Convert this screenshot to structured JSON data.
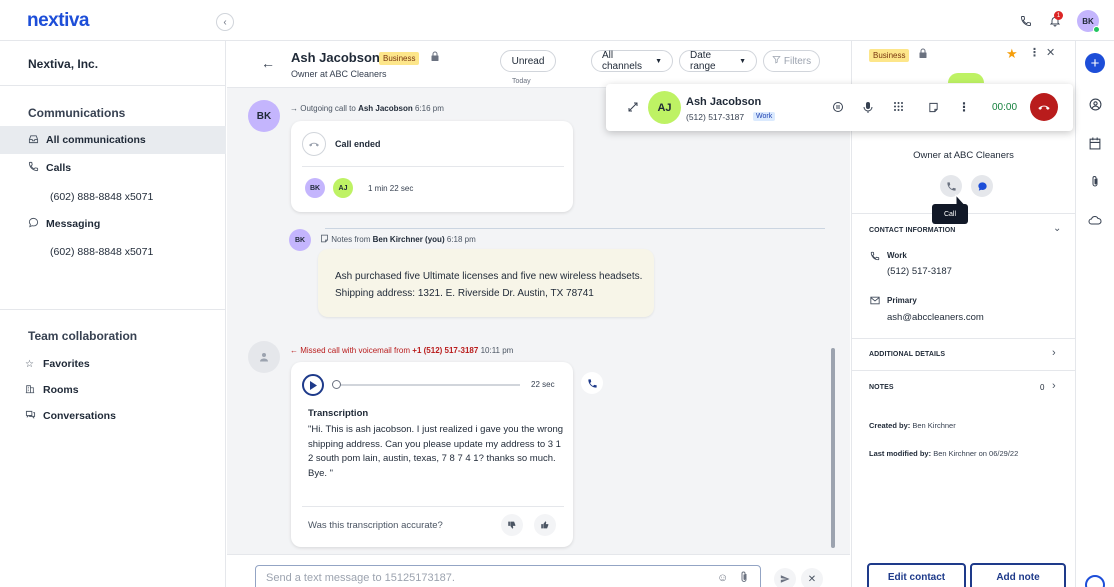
{
  "brand": {
    "logo_text": "nextiva",
    "accent": "#1d4ed8"
  },
  "topbar": {
    "icons": [
      "phone-icon",
      "bell-icon"
    ],
    "notification_count": "1",
    "user_initials": "BK"
  },
  "sidebar": {
    "org_name": "Nextiva, Inc.",
    "communications": {
      "heading": "Communications",
      "all_label": "All communications",
      "calls_label": "Calls",
      "calls_number": "(602) 888-8848 x5071",
      "messaging_label": "Messaging",
      "messaging_number": "(602) 888-8848 x5071"
    },
    "team": {
      "heading": "Team collaboration",
      "favorites": "Favorites",
      "rooms": "Rooms",
      "conversations": "Conversations"
    }
  },
  "conversation": {
    "header": {
      "name": "Ash Jacobson",
      "badge": "Business",
      "subtitle": "Owner at ABC Cleaners",
      "unread_label": "Unread",
      "channels_label": "All channels",
      "date_range_label": "Date range",
      "filters_label": "Filters",
      "today_label": "Today"
    },
    "outgoing_call": {
      "avatar": "BK",
      "prefix": "Outgoing call to",
      "name": "Ash Jacobson",
      "time": "6:16 pm",
      "status": "Call ended",
      "participants": [
        "BK",
        "AJ"
      ],
      "duration": "1 min 22 sec"
    },
    "note": {
      "avatar": "BK",
      "prefix": "Notes from",
      "author": "Ben Kirchner (you)",
      "time": "6:18 pm",
      "text": "Ash purchased five Ultimate licenses and five new wireless headsets. Shipping address: 1321. E. Riverside Dr. Austin, TX 78741"
    },
    "missed_call": {
      "prefix": "Missed call with voicemail from",
      "number": "+1 (512) 517-3187",
      "time": "10:11 pm",
      "audio_length": "22 sec",
      "transcription_heading": "Transcription",
      "transcription_text": "\"Hi. This is ash jacobson. I just realized i gave you the wrong shipping address. Can you please update my address to 3 1 2 south pom lain, austin, texas, 7 8 7 4 1? thanks so much. Bye. \"",
      "feedback_question": "Was this transcription accurate?"
    },
    "compose": {
      "placeholder": "Send a text message to  15125173187."
    }
  },
  "active_call": {
    "initials": "AJ",
    "name": "Ash Jacobson",
    "number": "(512) 517-3187",
    "label": "Work",
    "timer": "00:00"
  },
  "contact_panel": {
    "badge": "Business",
    "title": "Owner at ABC Cleaners",
    "tooltip": "Call",
    "contact_info_heading": "CONTACT INFORMATION",
    "work_label": "Work",
    "work_number": "(512) 517-3187",
    "email_label": "Primary",
    "email": "ash@abccleaners.com",
    "additional_details": "ADDITIONAL DETAILS",
    "notes_heading": "NOTES",
    "notes_count": "0",
    "created_by_label": "Created by:",
    "created_by": "Ben Kirchner",
    "modified_label": "Last modified by:",
    "modified_by": "Ben Kirchner on 06/29/22",
    "edit_button": "Edit contact",
    "add_note_button": "Add note"
  },
  "colors": {
    "business_badge": "#fde68a",
    "missed_red": "#b91c1c",
    "hangup_red": "#b91c1c",
    "timer_green": "#15803d",
    "bk_avatar": "#c4b5fd",
    "aj_avatar": "#bef264",
    "primary_blue": "#1e3a8a"
  }
}
